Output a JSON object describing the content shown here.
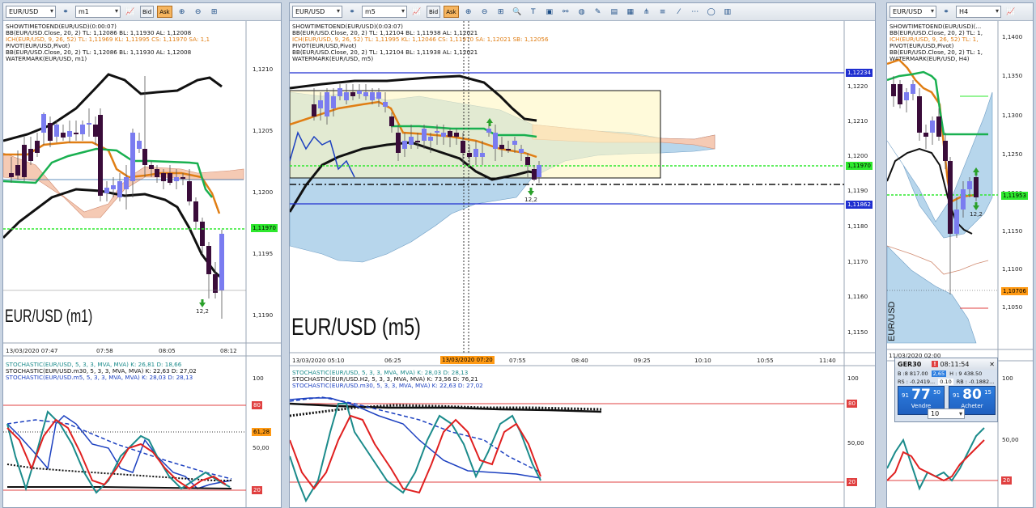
{
  "windows": [
    {
      "symbol": "EUR/USD",
      "timeframe": "m1",
      "bid_label": "Bid",
      "ask_label": "Ask",
      "indicators": [
        {
          "text": "SHOWTIMETOEND(EUR/USD)(0:00:07)",
          "color": "black"
        },
        {
          "text": "BB(EUR/USD.Close, 20, 2)  TL: 1,12086  BL: 1,11930  AL: 1,12008",
          "color": "black"
        },
        {
          "text": "ICH(EUR/USD, 9, 26, 52)  TL: 1,11969  KL: 1,11995  CS: 1,11970  SA: 1,1",
          "color": "orange"
        },
        {
          "text": "PIVOT(EUR/USD,Pivot)",
          "color": "black"
        },
        {
          "text": "BB(EUR/USD.Close, 20, 2)  TL: 1,12086  BL: 1,11930  AL: 1,12008",
          "color": "black"
        },
        {
          "text": "WATERMARK(EUR/USD, m1)",
          "color": "black"
        }
      ],
      "y_labels": [
        "1,1210",
        "1,1205",
        "1,1200",
        "1,1195",
        "1,1190"
      ],
      "price_tag": "1,11970",
      "x_labels": [
        "13/03/2020 07:47",
        "07:58",
        "08:05",
        "08:12"
      ],
      "watermark": "EUR/USD (m1)",
      "arrow_label": "12,2",
      "stoch_lines": [
        {
          "text": "STOCHASTIC(EUR/USD, 5, 3, 3, MVA, MVA)  K: 26,81  D: 18,66",
          "color": "teal"
        },
        {
          "text": "STOCHASTIC(EUR/USD.m30, 5, 3, 3, MVA, MVA)  K: 22,63  D: 27,02",
          "color": "black"
        },
        {
          "text": "STOCHASTIC(EUR/USD.m5, 5, 3, 3, MVA, MVA)  K: 28,03  D: 28,13",
          "color": "blue"
        }
      ],
      "stoch_y": [
        "100",
        "80",
        "50,00",
        "20"
      ],
      "stoch_tag": "61,28"
    },
    {
      "symbol": "EUR/USD",
      "timeframe": "m5",
      "bid_label": "Bid",
      "ask_label": "Ask",
      "indicators": [
        {
          "text": "SHOWTIMETOEND(EUR/USD)(0:03:07)",
          "color": "black"
        },
        {
          "text": "BB(EUR/USD.Close, 20, 2)  TL: 1,12104  BL: 1,11938  AL: 1,12021",
          "color": "black"
        },
        {
          "text": "ICH(EUR/USD, 9, 26, 52)  TL: 1,11995  KL: 1,12046  CS: 1,11970  SA: 1,12021  SB: 1,12056",
          "color": "orange"
        },
        {
          "text": "PIVOT(EUR/USD,Pivot)",
          "color": "black"
        },
        {
          "text": "BB(EUR/USD.Close, 20, 2)  TL: 1,12104  BL: 1,11938  AL: 1,12021",
          "color": "black"
        },
        {
          "text": "WATERMARK(EUR/USD, m5)",
          "color": "black"
        }
      ],
      "y_labels": [
        "1,1220",
        "1,1210",
        "1,1200",
        "1,1190",
        "1,1180",
        "1,1170",
        "1,1160",
        "1,1150"
      ],
      "price_tags": [
        {
          "text": "1,12234",
          "style": "blue"
        },
        {
          "text": "1,11970",
          "style": "green"
        },
        {
          "text": "1,11862",
          "style": "blue"
        }
      ],
      "x_labels": [
        "13/03/2020 05:10",
        "06:25",
        "07:55",
        "08:40",
        "09:25",
        "10:10",
        "10:55",
        "11:40"
      ],
      "x_highlight": "13/03/2020 07:20",
      "watermark": "EUR/USD (m5)",
      "arrow_label": "12,2",
      "stoch_lines": [
        {
          "text": "STOCHASTIC(EUR/USD, 5, 3, 3, MVA, MVA)  K: 28,03  D: 28,13",
          "color": "teal"
        },
        {
          "text": "STOCHASTIC(EUR/USD.H2, 5, 3, 3, MVA, MVA)  K: 73,56  D: 76,21",
          "color": "black"
        },
        {
          "text": "STOCHASTIC(EUR/USD.m30, 5, 3, 3, MVA, MVA)  K: 22,63  D: 27,02",
          "color": "blue"
        }
      ],
      "stoch_y": [
        "100",
        "80",
        "50,00",
        "20"
      ]
    },
    {
      "symbol": "EUR/USD",
      "timeframe": "H4",
      "indicators": [
        {
          "text": "SHOWTIMETOEND(EUR/USD)(...",
          "color": "black"
        },
        {
          "text": "BB(EUR/USD.Close, 20, 2)  TL: 1,",
          "color": "black"
        },
        {
          "text": "ICH(EUR/USD, 9, 26, 52)  TL: 1,",
          "color": "orange"
        },
        {
          "text": "PIVOT(EUR/USD,Pivot)",
          "color": "black"
        },
        {
          "text": "BB(EUR/USD.Close, 20, 2)  TL: 1,",
          "color": "black"
        },
        {
          "text": "WATERMARK(EUR/USD, H4)",
          "color": "black"
        }
      ],
      "y_labels": [
        "1,1400",
        "1,1350",
        "1,1300",
        "1,1250",
        "1,1200",
        "1,1150",
        "1,1100",
        "1,1050"
      ],
      "price_tags": [
        {
          "text": "1,11953",
          "style": "green"
        },
        {
          "text": "1,10706",
          "style": "orange"
        }
      ],
      "x_labels": [
        "11/03/2020 02:00"
      ],
      "watermark": "EUR/USD",
      "arrow_label": "12,2",
      "stoch_y": [
        "100",
        "80",
        "50,00",
        "20"
      ]
    }
  ],
  "trade_ticket": {
    "symbol": "GER30",
    "time": "08:11:54",
    "b_text": "B :8 817.00",
    "spread": "2,65",
    "h_text": "H : 9 438.50",
    "rs_text": "RS : -0.2419...",
    "mid": "0.10",
    "rb_text": "RB : -0.1882...",
    "sell": {
      "prefix": "91",
      "big": "77",
      "sup": "50",
      "label": "Vendre"
    },
    "buy": {
      "prefix": "91",
      "big": "80",
      "sup": "15",
      "label": "Acheter"
    },
    "qty": "10"
  },
  "colors": {
    "bb": "#111111",
    "tenkan": "#e07e14",
    "kijun": "#19b050",
    "cloud_up": "#b7d6ec",
    "cloud_down": "#f5cab4",
    "candle_bull": "#7a7cf0",
    "candle_bear": "#3a0c3a"
  }
}
